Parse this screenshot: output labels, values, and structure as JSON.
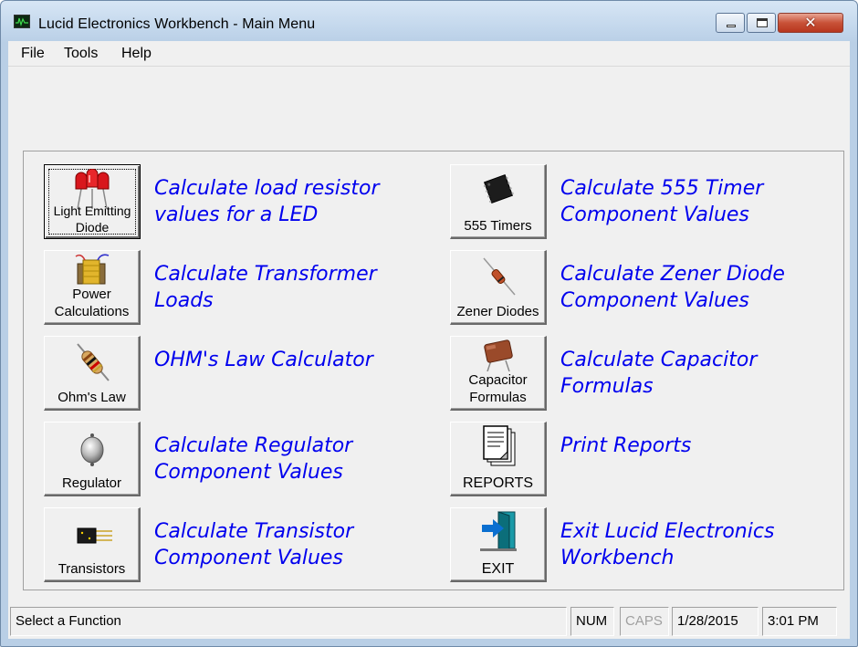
{
  "window": {
    "title": "Lucid Electronics Workbench - Main Menu",
    "close_glyph": "✕"
  },
  "menu": [
    "File",
    "Tools",
    "Help"
  ],
  "left_functions": [
    {
      "button_label": "Light Emitting Diode",
      "icon": "led-icon",
      "description": "Calculate load resistor values for a LED"
    },
    {
      "button_label": "Power Calculations",
      "icon": "transformer-icon",
      "description": "Calculate Transformer Loads"
    },
    {
      "button_label": "Ohm's Law",
      "icon": "resistor-icon",
      "description": "OHM's Law Calculator"
    },
    {
      "button_label": "Regulator",
      "icon": "regulator-icon",
      "description": "Calculate Regulator Component Values"
    },
    {
      "button_label": "Transistors",
      "icon": "transistor-icon",
      "description": "Calculate Transistor Component Values"
    }
  ],
  "right_functions": [
    {
      "button_label": "555 Timers",
      "icon": "ic-chip-icon",
      "description": "Calculate 555 Timer Component Values"
    },
    {
      "button_label": "Zener Diodes",
      "icon": "zener-diode-icon",
      "description": "Calculate Zener Diode Component Values"
    },
    {
      "button_label": "Capacitor Formulas",
      "icon": "capacitor-icon",
      "description": "Calculate Capacitor Formulas"
    },
    {
      "button_label": "REPORTS",
      "icon": "report-document-icon",
      "description": "Print Reports"
    },
    {
      "button_label": "EXIT",
      "icon": "exit-door-icon",
      "description": "Exit Lucid Electronics Workbench"
    }
  ],
  "status": {
    "message": "Select a Function",
    "num": "NUM",
    "caps": "CAPS",
    "date": "1/28/2015",
    "time": "3:01 PM"
  },
  "colors": {
    "description_text": "#0000ee",
    "face": "#f0f0f0"
  }
}
